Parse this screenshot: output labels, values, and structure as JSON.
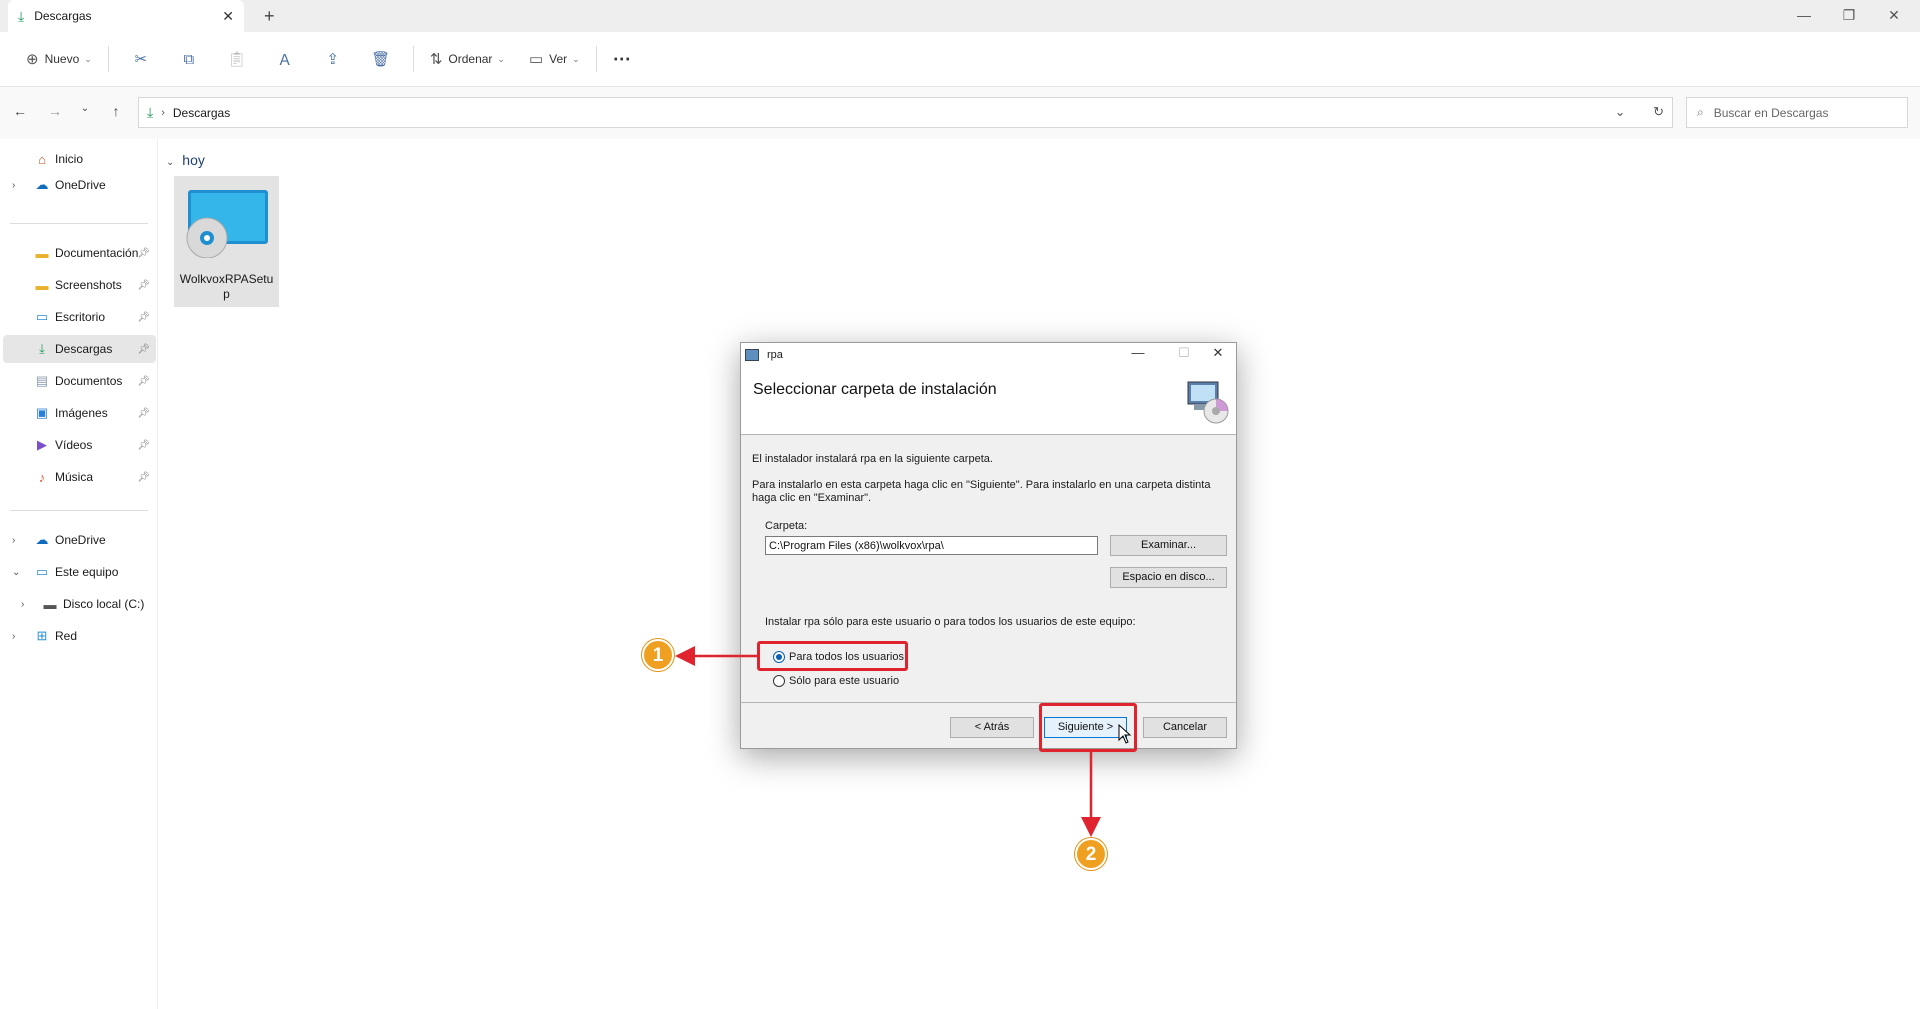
{
  "window": {
    "tab_title": "Descargas",
    "tab_close": "✕",
    "new_tab": "+",
    "minimize": "—",
    "restore": "❐",
    "close": "✕"
  },
  "toolbar": {
    "new_label": "Nuevo",
    "sort_label": "Ordenar",
    "view_label": "Ver",
    "more_label": "⋯",
    "icons": [
      "cut-icon",
      "copy-icon",
      "paste-icon",
      "rename-icon",
      "share-icon",
      "delete-icon"
    ]
  },
  "address": {
    "path_segment": "Descargas",
    "search_placeholder": "Buscar en Descargas"
  },
  "sidebar": {
    "items": [
      {
        "label": "Inicio",
        "icon": "home-icon"
      },
      {
        "label": "OneDrive",
        "icon": "cloud-icon"
      },
      {
        "label": "Documentación",
        "icon": "folder-icon",
        "pinned": true
      },
      {
        "label": "Screenshots",
        "icon": "folder-icon",
        "pinned": true
      },
      {
        "label": "Escritorio",
        "icon": "desktop-icon",
        "pinned": true
      },
      {
        "label": "Descargas",
        "icon": "download-icon",
        "pinned": true,
        "selected": true
      },
      {
        "label": "Documentos",
        "icon": "document-icon",
        "pinned": true
      },
      {
        "label": "Imágenes",
        "icon": "image-icon",
        "pinned": true
      },
      {
        "label": "Vídeos",
        "icon": "video-icon",
        "pinned": true
      },
      {
        "label": "Música",
        "icon": "music-icon",
        "pinned": true
      },
      {
        "label": "OneDrive",
        "icon": "cloud-icon"
      },
      {
        "label": "Este equipo",
        "icon": "computer-icon"
      },
      {
        "label": "Disco local (C:)",
        "icon": "drive-icon"
      },
      {
        "label": "Red",
        "icon": "network-icon"
      }
    ]
  },
  "main": {
    "group_label": "hoy",
    "files": [
      {
        "name": "WolkvoxRPASetup",
        "icon": "installer-icon"
      }
    ]
  },
  "dialog": {
    "title": "rpa",
    "heading": "Seleccionar carpeta de instalación",
    "intro": "El instalador instalará rpa en la siguiente carpeta.",
    "instructions": "Para instalarlo en esta carpeta haga clic en \"Siguiente\". Para instalarlo en una carpeta distinta haga clic en \"Examinar\".",
    "folder_label": "Carpeta:",
    "folder_value": "C:\\Program Files (x86)\\wolkvox\\rpa\\",
    "browse_button": "Examinar...",
    "disk_space_button": "Espacio en disco...",
    "scope_question": "Instalar rpa sólo para este usuario o para todos los usuarios de este equipo:",
    "radio_all_users": "Para todos los usuarios",
    "radio_this_user": "Sólo para este usuario",
    "selected_scope": "all_users",
    "back_button": "< Atrás",
    "next_button": "Siguiente >",
    "cancel_button": "Cancelar"
  },
  "annotations": {
    "marker_1": "1",
    "marker_2": "2",
    "highlight_color": "#e0242f",
    "marker_color": "#f0a020"
  }
}
